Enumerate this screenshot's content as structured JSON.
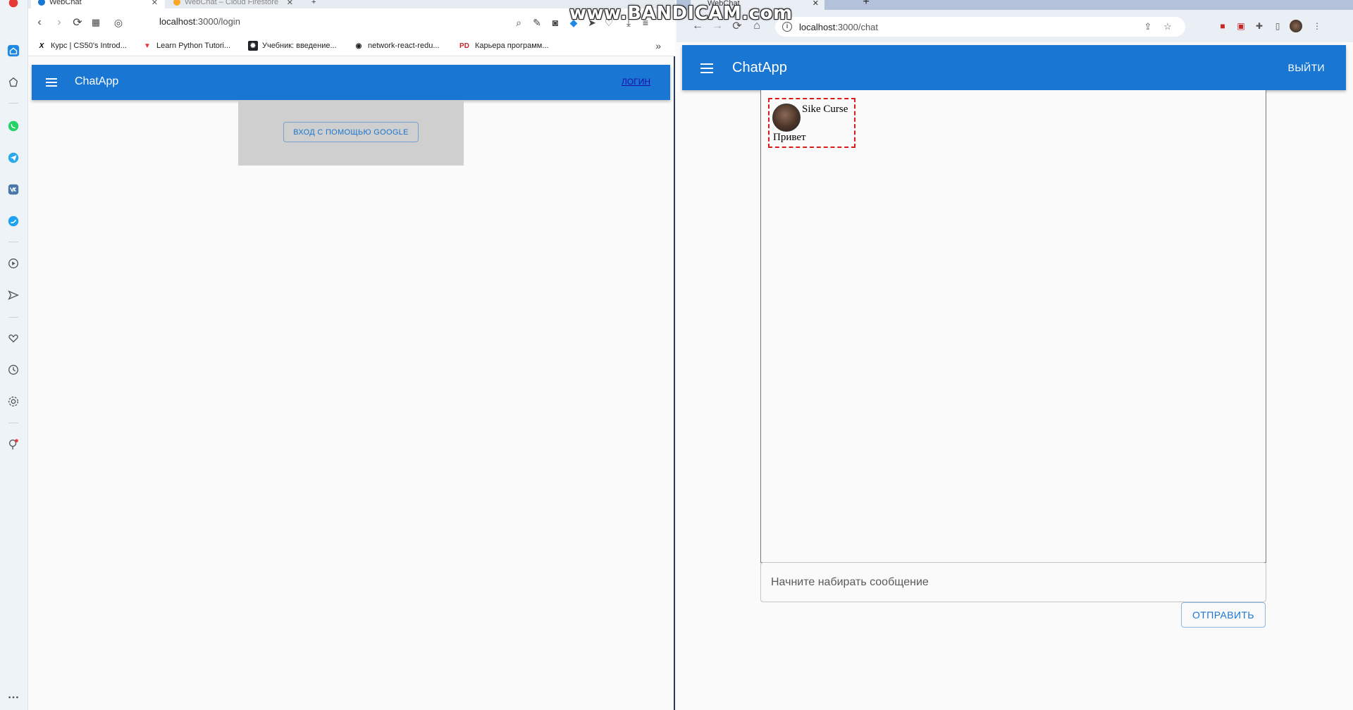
{
  "watermark": "www.BANDICAM.com",
  "left": {
    "tabs": [
      {
        "label": "WebChat"
      },
      {
        "label": "WebChat – Cloud Firestore"
      }
    ],
    "url": {
      "host": "localhost",
      "path": ":3000/login"
    },
    "bookmarks": [
      {
        "icon": "X",
        "label": "Курс | CS50's Introd..."
      },
      {
        "icon": "▼",
        "label": "Learn Python Tutori..."
      },
      {
        "icon": "✹",
        "label": "Учебник: введение..."
      },
      {
        "icon": "◉",
        "label": "network-react-redu..."
      },
      {
        "icon": "PD",
        "label": "Карьера программ..."
      }
    ],
    "bookmarks_more": "»",
    "appbar": {
      "title": "ChatApp",
      "login_label": "ЛОГИН"
    },
    "login_button": "ВХОД С ПОМОЩЬЮ GOOGLE"
  },
  "right": {
    "tab": {
      "label": "WebChat"
    },
    "url": {
      "host": "localhost",
      "path": ":3000/chat"
    },
    "appbar": {
      "title": "ChatApp",
      "logout_label": "ВЫЙТИ"
    },
    "messages": [
      {
        "user": "Sike Curse",
        "text": "Привет"
      }
    ],
    "input": {
      "placeholder": "Начните набирать сообщение",
      "value": ""
    },
    "send_label": "ОТПРАВИТЬ"
  },
  "colors": {
    "accent": "#1976d2",
    "highlight": "#d81b1b"
  }
}
